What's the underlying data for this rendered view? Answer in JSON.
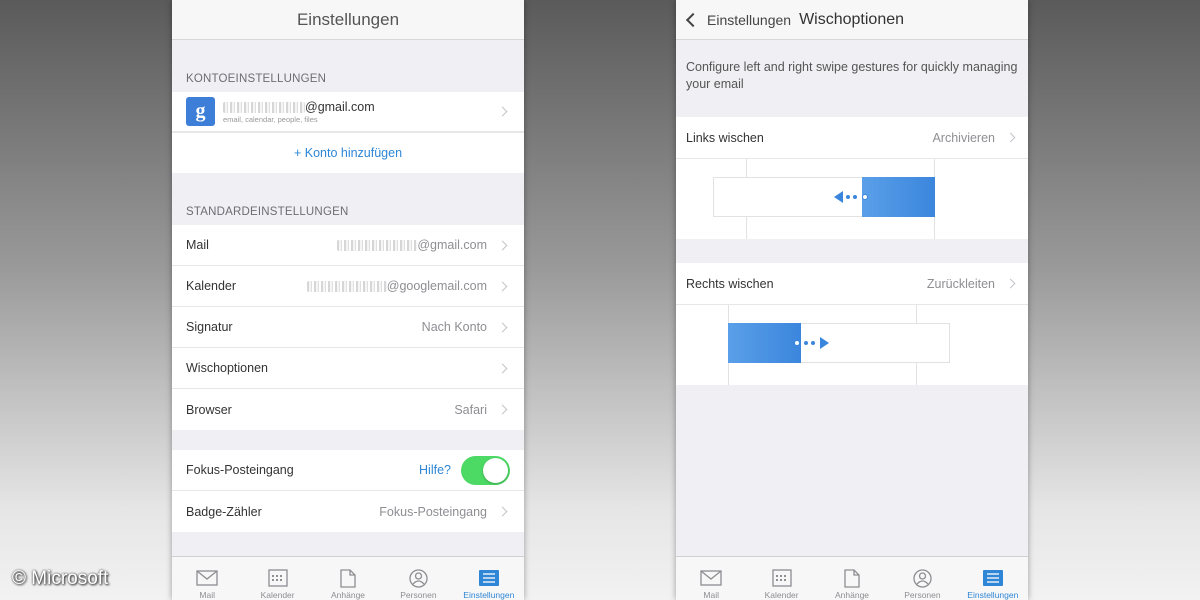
{
  "left": {
    "title": "Einstellungen",
    "account_section": "KONTOEINSTELLUNGEN",
    "account": {
      "email_suffix": "@gmail.com",
      "sub": "email, calendar, people, files",
      "logo_letter": "g"
    },
    "add_account": "+ Konto hinzufügen",
    "defaults_section": "STANDARDEINSTELLUNGEN",
    "rows": [
      {
        "label": "Mail",
        "value": "@gmail.com"
      },
      {
        "label": "Kalender",
        "value": "@googlemail.com"
      },
      {
        "label": "Signatur",
        "value": "Nach Konto"
      },
      {
        "label": "Wischoptionen",
        "value": ""
      },
      {
        "label": "Browser",
        "value": "Safari"
      }
    ],
    "focus": {
      "label": "Fokus-Posteingang",
      "help": "Hilfe?",
      "enabled": true
    },
    "badge": {
      "label": "Badge-Zähler",
      "value": "Fokus-Posteingang"
    }
  },
  "right": {
    "back_label": "Einstellungen",
    "title": "Wischoptionen",
    "description": "Configure left and right swipe gestures for quickly managing your email",
    "left_swipe": {
      "label": "Links wischen",
      "value": "Archivieren"
    },
    "right_swipe": {
      "label": "Rechts wischen",
      "value": "Zurückleiten"
    }
  },
  "tabs": [
    {
      "label": "Mail",
      "icon": "mail-icon"
    },
    {
      "label": "Kalender",
      "icon": "calendar-icon"
    },
    {
      "label": "Anhänge",
      "icon": "file-icon"
    },
    {
      "label": "Personen",
      "icon": "person-icon"
    },
    {
      "label": "Einstellungen",
      "icon": "settings-icon"
    }
  ],
  "watermark": "© Microsoft",
  "colors": {
    "accent": "#2f86d6",
    "toggle_on": "#4cd964",
    "google_blue": "#3c7ed8"
  }
}
